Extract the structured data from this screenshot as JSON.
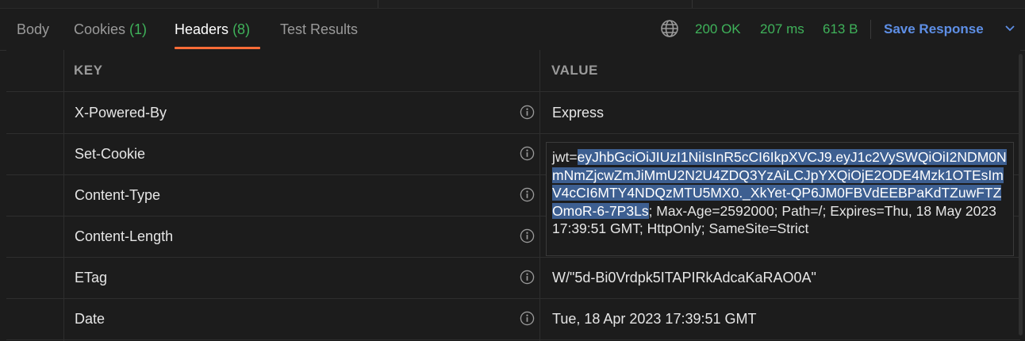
{
  "tabs": [
    {
      "label": "Body",
      "count": ""
    },
    {
      "label": "Cookies",
      "count": "(1)"
    },
    {
      "label": "Headers",
      "count": "(8)"
    },
    {
      "label": "Test Results",
      "count": ""
    }
  ],
  "active_tab": "Headers",
  "status": {
    "code": "200 OK",
    "time": "207 ms",
    "size": "613 B",
    "save_label": "Save Response"
  },
  "table": {
    "key_header": "KEY",
    "value_header": "VALUE",
    "rows": [
      {
        "key": "X-Powered-By",
        "value": "Express"
      },
      {
        "key": "Set-Cookie",
        "value": ""
      },
      {
        "key": "Content-Type",
        "value": ""
      },
      {
        "key": "Content-Length",
        "value": ""
      },
      {
        "key": "ETag",
        "value": "W/\"5d-Bi0Vrdpk5ITAPIRkAdcaKaRAO0A\""
      },
      {
        "key": "Date",
        "value": "Tue, 18 Apr 2023 17:39:51 GMT"
      }
    ]
  },
  "cookie_value": {
    "prefix": "jwt=",
    "selected": "eyJhbGciOiJIUzI1NiIsInR5cCI6IkpXVCJ9.eyJ1c2VySWQiOiI2NDM0NmNmZjcwZmJiMmU2N2U4ZDQ3YzAiLCJpYXQiOjE2ODE4Mzk1OTEsImV4cCI6MTY4NDQzMTU5MX0._XkYet-QP6JM0FBVdEEBPaKdTZuwFTZOmoR-6-7P3Ls",
    "rest": "; Max-Age=2592000; Path=/; Expires=Thu, 18 May 2023 17:39:51 GMT; HttpOnly; SameSite=Strict"
  },
  "colors": {
    "accent": "#ff6c37",
    "status_green": "#3fb25a",
    "link_blue": "#5e8fe6",
    "selection": "#3d5f91"
  },
  "icons": [
    "globe-icon",
    "chevron-down-icon",
    "info-icon"
  ]
}
